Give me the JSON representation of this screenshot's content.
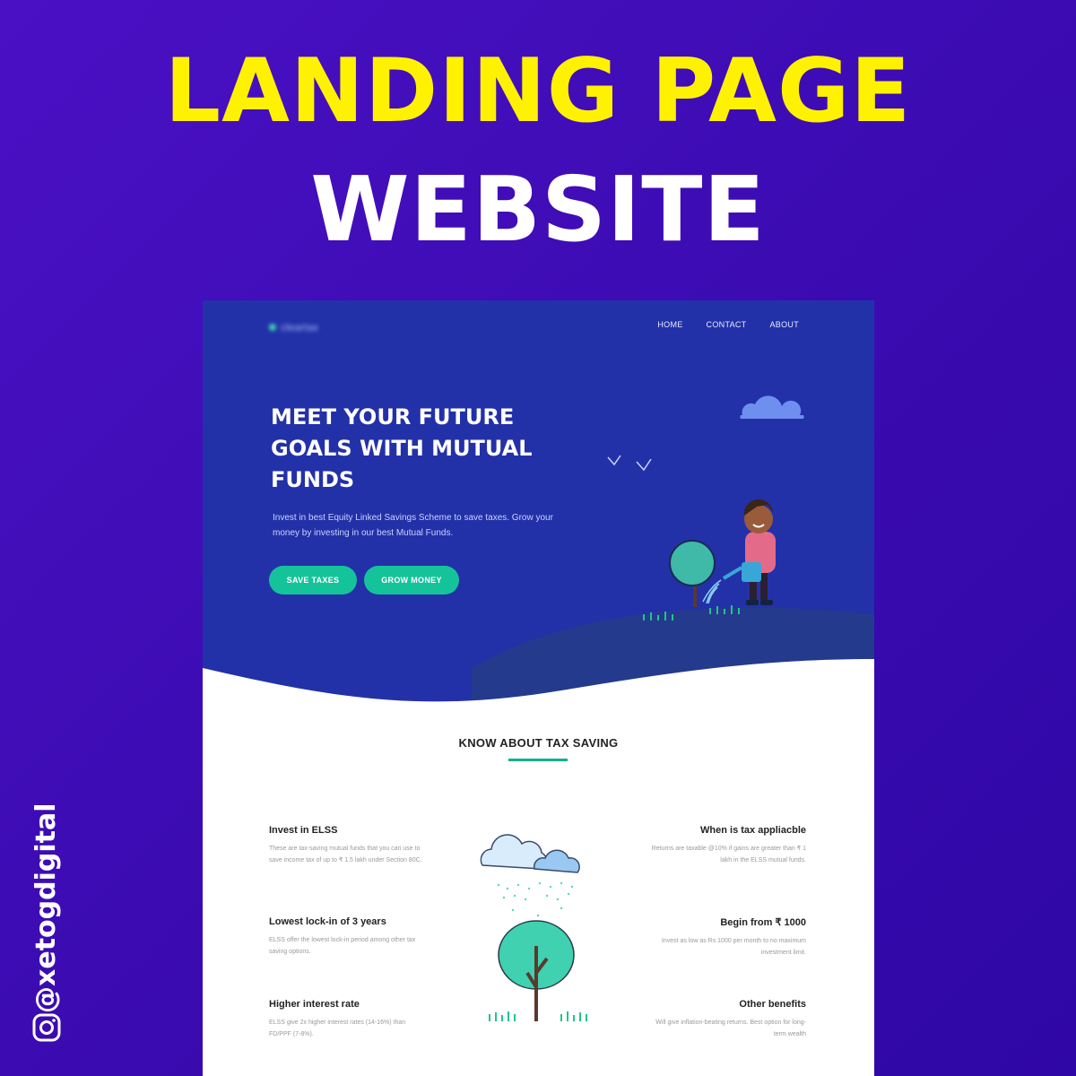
{
  "poster": {
    "line1": "LANDING PAGE",
    "line2": "WEBSITE",
    "handle": "@xetogdigital",
    "bg_color": "#3a0bb0",
    "accent_yellow": "#fff200"
  },
  "site": {
    "logo_text": "cleartax",
    "nav": [
      "HOME",
      "CONTACT",
      "ABOUT"
    ],
    "hero": {
      "title": "MEET YOUR FUTURE GOALS WITH MUTUAL FUNDS",
      "subtitle": "Invest in best Equity Linked Savings Scheme to save taxes. Grow your money by investing in our best Mutual Funds.",
      "buttons": [
        "SAVE TAXES",
        "GROW MONEY"
      ],
      "bg_color": "#2331a8",
      "button_color": "#15c39a"
    },
    "section": {
      "title": "KNOW ABOUT TAX SAVING",
      "features_left": [
        {
          "title": "Invest in ELSS",
          "text": "These are tax-saving mutual funds that you can use to save income tax of up to ₹ 1.5 lakh under Section 80C."
        },
        {
          "title": "Lowest lock-in of 3 years",
          "text": "ELSS offer the lowest lock-in period among other tax saving options."
        },
        {
          "title": "Higher interest rate",
          "text": "ELSS give 2x higher interest rates (14-16%) than FD/PPF (7-8%)."
        }
      ],
      "features_right": [
        {
          "title": "When is tax appliacble",
          "text": "Returns are taxable @10% if gains are greater than ₹ 1 lakh in the ELSS mutual funds."
        },
        {
          "title": "Begin from ₹ 1000",
          "text": "Invest as low as Rs 1000 per month to no maximum investment limit."
        },
        {
          "title": "Other benefits",
          "text": "Will give inflation-beating returns. Best option for long-term wealth"
        }
      ]
    }
  }
}
